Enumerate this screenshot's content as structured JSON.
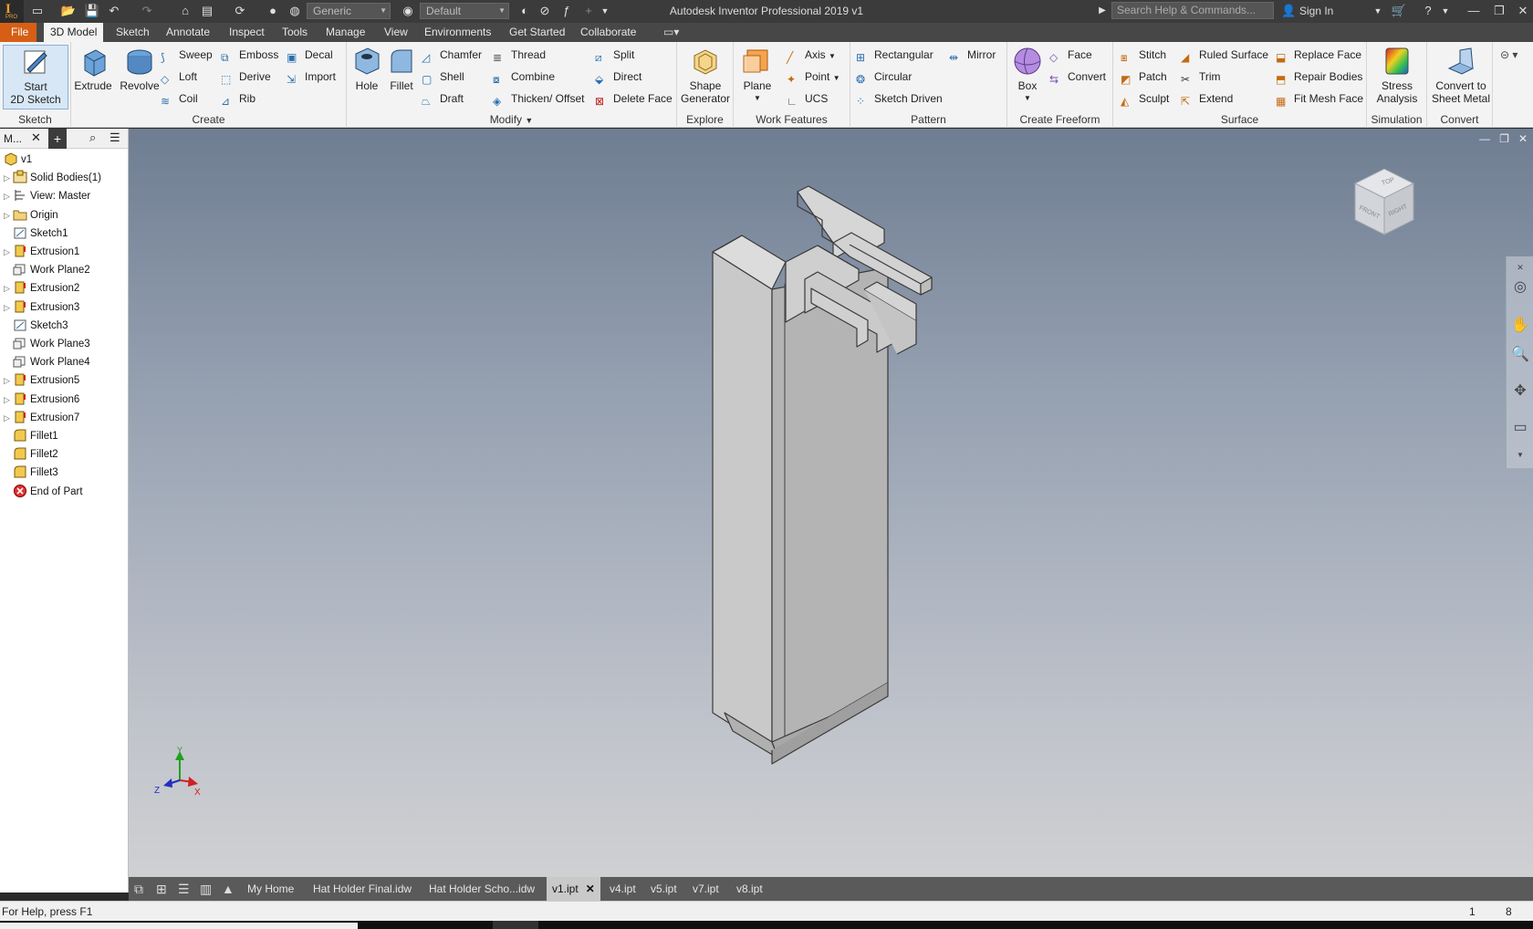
{
  "app": {
    "title": "Autodesk Inventor Professional 2019    v1",
    "logo_text": "I",
    "logo_sub": "PRO"
  },
  "quick_access": {
    "material": "Generic",
    "appearance": "Default"
  },
  "search": {
    "placeholder": "Search Help & Commands..."
  },
  "user": {
    "sign_in": "Sign In"
  },
  "menu_tabs": [
    "File",
    "3D Model",
    "Sketch",
    "Annotate",
    "Inspect",
    "Tools",
    "Manage",
    "View",
    "Environments",
    "Get Started",
    "Collaborate"
  ],
  "ribbon": {
    "sketch": {
      "title": "Sketch",
      "start": "Start",
      "start2": "2D Sketch"
    },
    "create": {
      "title": "Create",
      "extrude": "Extrude",
      "revolve": "Revolve",
      "sweep": "Sweep",
      "loft": "Loft",
      "coil": "Coil",
      "emboss": "Emboss",
      "derive": "Derive",
      "rib": "Rib",
      "decal": "Decal",
      "import": "Import"
    },
    "modify": {
      "title": "Modify",
      "hole": "Hole",
      "fillet": "Fillet",
      "chamfer": "Chamfer",
      "shell": "Shell",
      "draft": "Draft",
      "thread": "Thread",
      "combine": "Combine",
      "thicken": "Thicken/ Offset",
      "split": "Split",
      "direct": "Direct",
      "delete_face": "Delete Face"
    },
    "explore": {
      "title": "Explore",
      "shape": "Shape",
      "shape2": "Generator"
    },
    "work_features": {
      "title": "Work Features",
      "plane": "Plane",
      "axis": "Axis",
      "point": "Point",
      "ucs": "UCS"
    },
    "pattern": {
      "title": "Pattern",
      "rectangular": "Rectangular",
      "circular": "Circular",
      "sketch_driven": "Sketch Driven",
      "mirror": "Mirror"
    },
    "freeform": {
      "title": "Create Freeform",
      "box": "Box",
      "face": "Face",
      "convert": "Convert"
    },
    "surface": {
      "title": "Surface",
      "stitch": "Stitch",
      "patch": "Patch",
      "sculpt": "Sculpt",
      "ruled": "Ruled Surface",
      "trim": "Trim",
      "extend": "Extend",
      "replace": "Replace Face",
      "repair": "Repair Bodies",
      "fit_mesh": "Fit Mesh Face"
    },
    "simulation": {
      "title": "Simulation",
      "stress": "Stress",
      "stress2": "Analysis"
    },
    "convert": {
      "title": "Convert",
      "sheet": "Convert to",
      "sheet2": "Sheet Metal"
    }
  },
  "browser": {
    "header": "M...",
    "tree": [
      {
        "label": "v1",
        "icon": "part-icon",
        "exp": false
      },
      {
        "label": "Solid Bodies(1)",
        "icon": "solid-bodies-icon",
        "exp": true
      },
      {
        "label": "View: Master",
        "icon": "view-icon",
        "exp": true
      },
      {
        "label": "Origin",
        "icon": "folder-icon",
        "exp": true
      },
      {
        "label": "Sketch1",
        "icon": "sketch-icon",
        "exp": false
      },
      {
        "label": "Extrusion1",
        "icon": "extrusion-icon",
        "exp": true
      },
      {
        "label": "Work Plane2",
        "icon": "workplane-icon",
        "exp": false
      },
      {
        "label": "Extrusion2",
        "icon": "extrusion-icon",
        "exp": true
      },
      {
        "label": "Extrusion3",
        "icon": "extrusion-icon",
        "exp": true
      },
      {
        "label": "Sketch3",
        "icon": "sketch-icon",
        "exp": false
      },
      {
        "label": "Work Plane3",
        "icon": "workplane-icon",
        "exp": false
      },
      {
        "label": "Work Plane4",
        "icon": "workplane-icon",
        "exp": false
      },
      {
        "label": "Extrusion5",
        "icon": "extrusion-icon",
        "exp": true
      },
      {
        "label": "Extrusion6",
        "icon": "extrusion-icon",
        "exp": true
      },
      {
        "label": "Extrusion7",
        "icon": "extrusion-icon",
        "exp": true
      },
      {
        "label": "Fillet1",
        "icon": "fillet-icon",
        "exp": false
      },
      {
        "label": "Fillet2",
        "icon": "fillet-icon",
        "exp": false
      },
      {
        "label": "Fillet3",
        "icon": "fillet-icon",
        "exp": false
      },
      {
        "label": "End of Part",
        "icon": "end-of-part-icon",
        "exp": false
      }
    ]
  },
  "viewcube": {
    "top": "TOP",
    "front": "FRONT",
    "right": "RIGHT"
  },
  "triad": {
    "x": "X",
    "y": "Y",
    "z": "Z"
  },
  "doc_tabs": [
    "My Home",
    "Hat Holder Final.idw",
    "Hat Holder Scho...idw",
    "v1.ipt",
    "v4.ipt",
    "v5.ipt",
    "v7.ipt",
    "v8.ipt"
  ],
  "active_doc": "v1.ipt",
  "status": {
    "help": "For Help, press F1",
    "count1": "1",
    "count2": "8"
  },
  "colors": {
    "file_tab": "#d65f15",
    "title_bar": "#3b3b3b",
    "ribbon": "#f3f3f3"
  }
}
